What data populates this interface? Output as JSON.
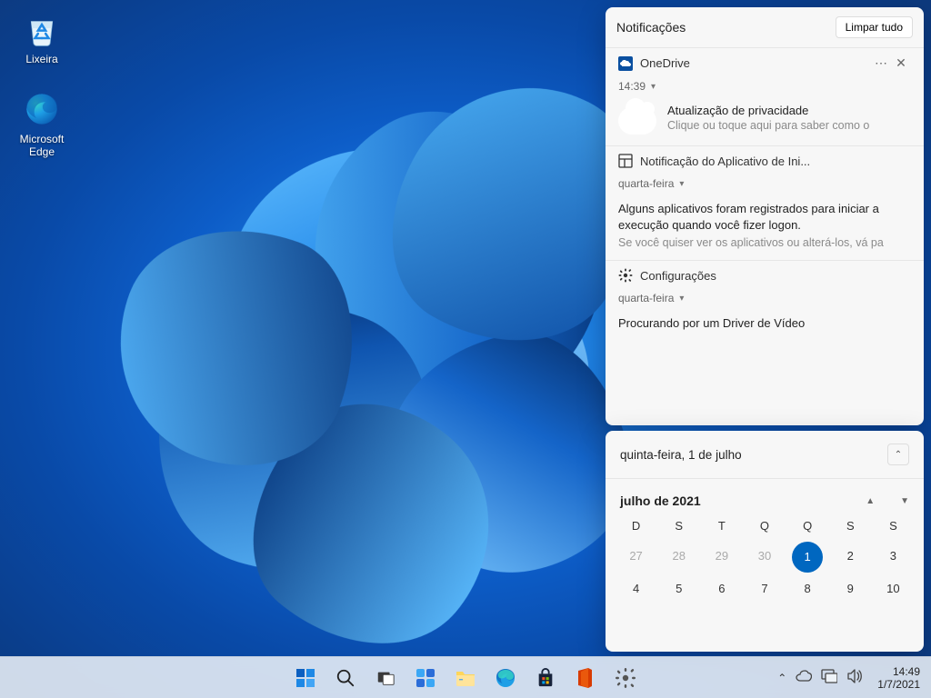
{
  "desktop": {
    "icons": [
      {
        "name": "recycle-bin",
        "label": "Lixeira"
      },
      {
        "name": "edge",
        "label": "Microsoft Edge"
      }
    ]
  },
  "notifications": {
    "title": "Notificações",
    "clear_label": "Limpar tudo",
    "groups": [
      {
        "app": "OneDrive",
        "time": "14:39",
        "title": "Atualização de privacidade",
        "subtitle": "Clique ou toque aqui para saber como o"
      },
      {
        "app": "Notificação do Aplicativo de Ini...",
        "time": "quarta-feira",
        "body": "Alguns aplicativos foram registrados para iniciar a execução quando você fizer logon.",
        "subtitle": "Se você quiser ver os aplicativos ou alterá-los, vá pa"
      },
      {
        "app": "Configurações",
        "time": "quarta-feira",
        "body": "Procurando por um Driver de Vídeo"
      }
    ]
  },
  "calendar": {
    "today_label": "quinta-feira, 1 de julho",
    "month_label": "julho de 2021",
    "day_headers": [
      "D",
      "S",
      "T",
      "Q",
      "Q",
      "S",
      "S"
    ],
    "weeks": [
      [
        {
          "n": 27,
          "muted": true
        },
        {
          "n": 28,
          "muted": true
        },
        {
          "n": 29,
          "muted": true
        },
        {
          "n": 30,
          "muted": true
        },
        {
          "n": 1,
          "today": true
        },
        {
          "n": 2
        },
        {
          "n": 3
        }
      ],
      [
        {
          "n": 4
        },
        {
          "n": 5
        },
        {
          "n": 6
        },
        {
          "n": 7
        },
        {
          "n": 8
        },
        {
          "n": 9
        },
        {
          "n": 10
        }
      ]
    ]
  },
  "taskbar": {
    "time": "14:49",
    "date": "1/7/2021"
  }
}
